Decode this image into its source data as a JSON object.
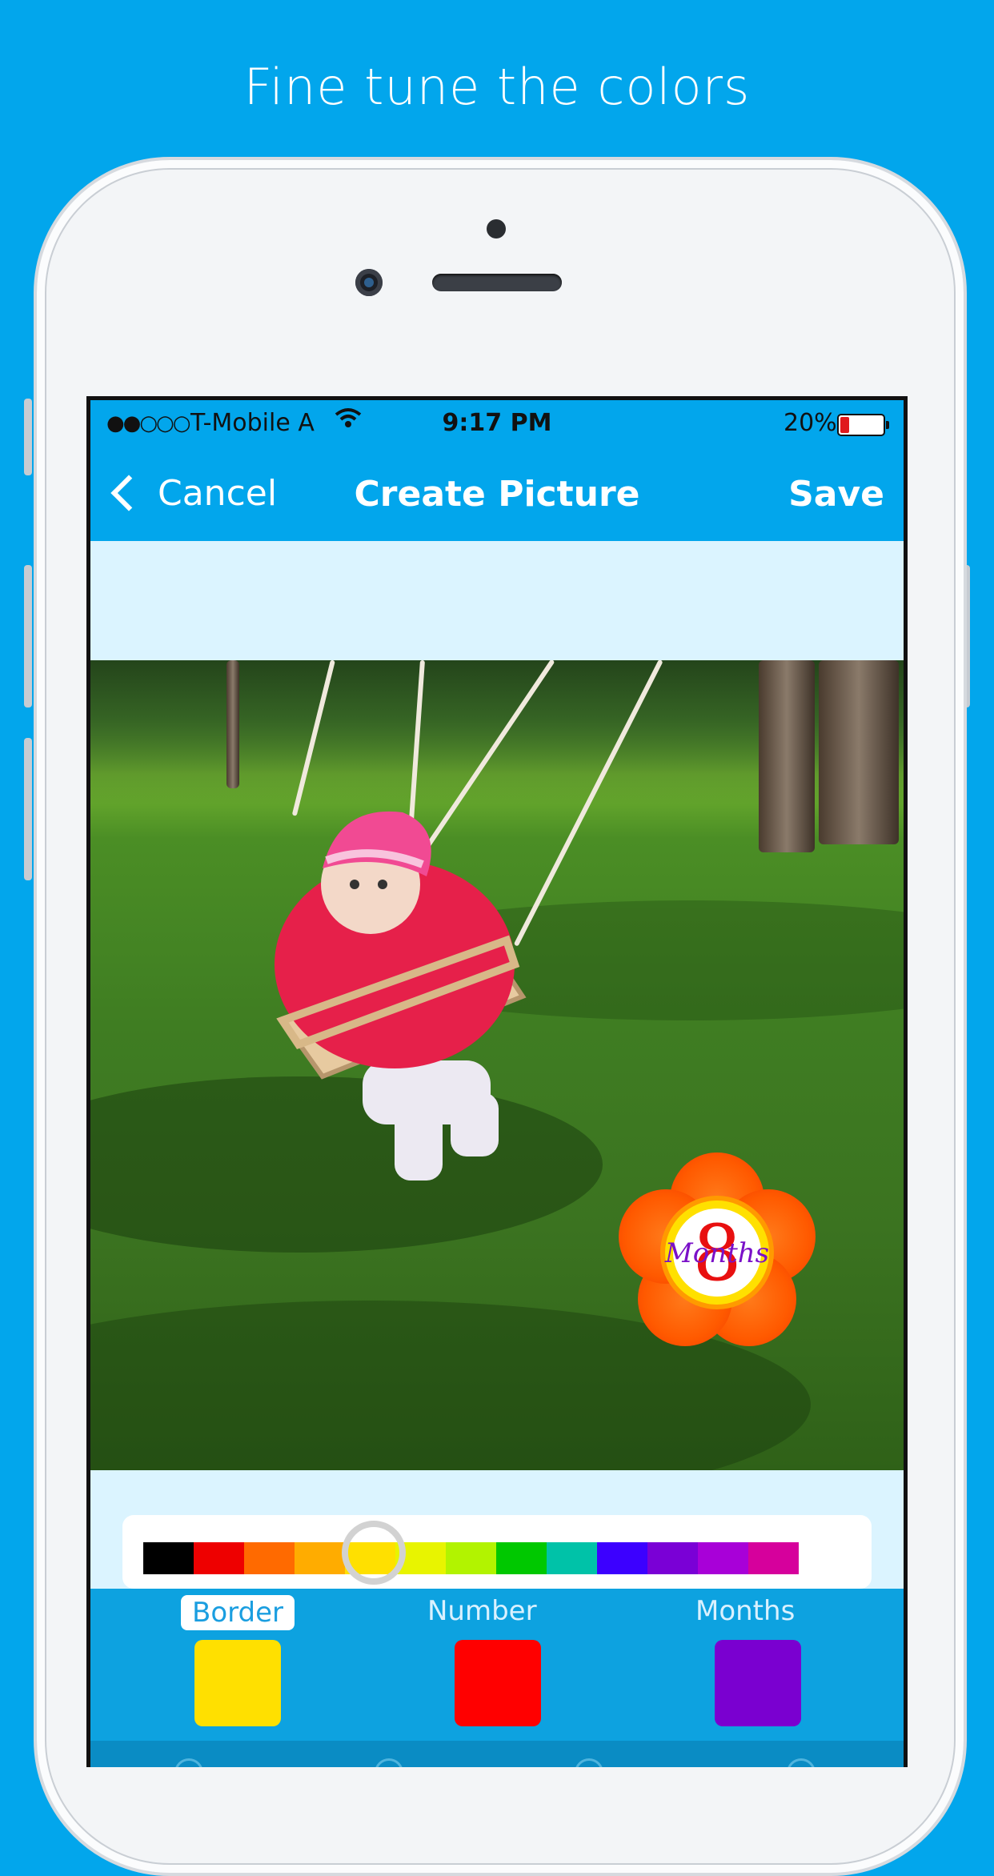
{
  "page": {
    "headline": "Fine tune the colors"
  },
  "status_bar": {
    "signal": "●●○○○",
    "carrier": "T-Mobile A",
    "wifi_icon": "wifi-icon",
    "time": "9:17 PM",
    "battery": "20%"
  },
  "nav": {
    "back_label": "Cancel",
    "title": "Create Picture",
    "save_label": "Save"
  },
  "badge": {
    "number": "8",
    "label": "Months"
  },
  "palette": {
    "colors": [
      "#000000",
      "#ee0000",
      "#ff6a00",
      "#ffac00",
      "#ffe000",
      "#e8f400",
      "#b2f300",
      "#00c800",
      "#00c2a8",
      "#3c00ff",
      "#7a00d6",
      "#a800d8",
      "#d6009c"
    ],
    "selected_color": "#ffe000"
  },
  "tabs": [
    {
      "label": "Border",
      "color": "#ffe000",
      "active": true
    },
    {
      "label": "Number",
      "color": "#ff0000",
      "active": false
    },
    {
      "label": "Months",
      "color": "#7a00d0",
      "active": false
    }
  ]
}
